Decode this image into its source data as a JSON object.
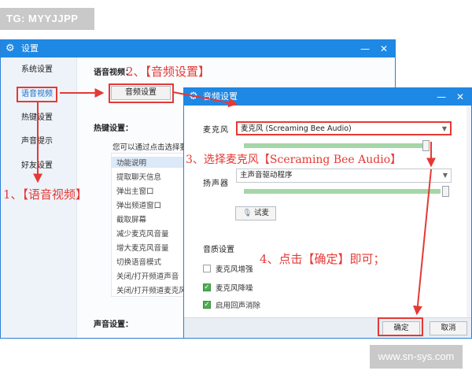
{
  "watermark": {
    "top_left": "TG: MYYJJPP",
    "bottom_right": "www.sn-sys.com"
  },
  "main_window": {
    "title": "设置",
    "icon": "gear-icon",
    "controls": {
      "minimize": "—",
      "close": "✕"
    },
    "sidebar": [
      {
        "label": "系统设置"
      },
      {
        "label": "语音视频",
        "active": true
      },
      {
        "label": "热键设置"
      },
      {
        "label": "声音提示"
      },
      {
        "label": "好友设置"
      }
    ],
    "section_voice": "语音视频：",
    "audio_button": "音频设置",
    "section_hotkey": "热键设置：",
    "hotkey_hint": "您可以通过点击选择要",
    "hotkeys": [
      "功能说明",
      "提取聊天信息",
      "弹出主窗口",
      "弹出频道窗口",
      "截取屏幕",
      "减少麦克风音量",
      "增大麦克风音量",
      "切换语音模式",
      "关闭/打开频道声音",
      "关闭/打开频道麦克风"
    ],
    "selected_hotkey": 0,
    "section_sound": "声音设置："
  },
  "audio_dialog": {
    "title": "音频设置",
    "controls": {
      "minimize": "—",
      "close": "✕"
    },
    "mic_label": "麦克风",
    "mic_value": "麦克风 (Screaming Bee Audio)",
    "mic_level": 0.93,
    "speaker_label": "扬声器",
    "speaker_value": "主声音驱动程序",
    "speaker_level": 1.0,
    "test_button": "试麦",
    "quality_label": "音质设置",
    "options": [
      {
        "label": "麦克风增强",
        "checked": false
      },
      {
        "label": "麦克风降噪",
        "checked": true
      },
      {
        "label": "启用回声消除",
        "checked": true
      }
    ],
    "ok_button": "确定",
    "cancel_button": "取消"
  },
  "annotations": {
    "step1": "1、【语音视频】",
    "step2": "2、【音频设置】",
    "step3": "3、选择麦克风【Sceraming Bee Audio】",
    "step4": "4、点击【确定】即可；",
    "color": "#e53935"
  }
}
